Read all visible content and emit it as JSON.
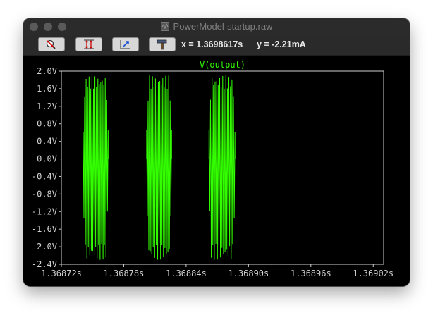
{
  "window": {
    "title": "PowerModel-startup.raw"
  },
  "toolbar": {
    "buttons": [
      {
        "name": "zoom-reset-button",
        "icon": "magnifier-cancel-icon"
      },
      {
        "name": "autorange-button",
        "icon": "vertical-arrows-icon"
      },
      {
        "name": "pan-button",
        "icon": "arrow-move-icon"
      },
      {
        "name": "hammer-button",
        "icon": "hammer-icon"
      }
    ],
    "cursor_x": "x = 1.3698617s",
    "cursor_y": "y = -2.21mA"
  },
  "colors": {
    "trace": "#33ff00",
    "axes": "#d0d0d0",
    "background": "#000000"
  },
  "chart_data": {
    "type": "line",
    "title": "V(output)",
    "xlabel": "",
    "ylabel": "",
    "xlim": [
      1.36872,
      1.36903
    ],
    "ylim": [
      -2.4,
      2.0
    ],
    "yticks": [
      "2.0V",
      "1.6V",
      "1.2V",
      "0.8V",
      "0.4V",
      "0.0V",
      "-0.4V",
      "-0.8V",
      "-1.2V",
      "-1.6V",
      "-2.0V",
      "-2.4V"
    ],
    "ytick_values": [
      2.0,
      1.6,
      1.2,
      0.8,
      0.4,
      0.0,
      -0.4,
      -0.8,
      -1.2,
      -1.6,
      -2.0,
      -2.4
    ],
    "xticks": [
      "1.36872s",
      "1.36878s",
      "1.36884s",
      "1.36890s",
      "1.36896s",
      "1.36902s"
    ],
    "xtick_values": [
      1.36872,
      1.36878,
      1.36884,
      1.3689,
      1.36896,
      1.36902
    ],
    "grid": false,
    "series": [
      {
        "name": "V(output)",
        "baseline": 0.0,
        "bursts": [
          {
            "start": 1.368741,
            "end": 1.368765,
            "peak": 1.9,
            "trough": -2.3
          },
          {
            "start": 1.368802,
            "end": 1.368826,
            "peak": 1.9,
            "trough": -2.3
          },
          {
            "start": 1.368862,
            "end": 1.368887,
            "peak": 1.9,
            "trough": -2.3
          }
        ]
      }
    ]
  }
}
